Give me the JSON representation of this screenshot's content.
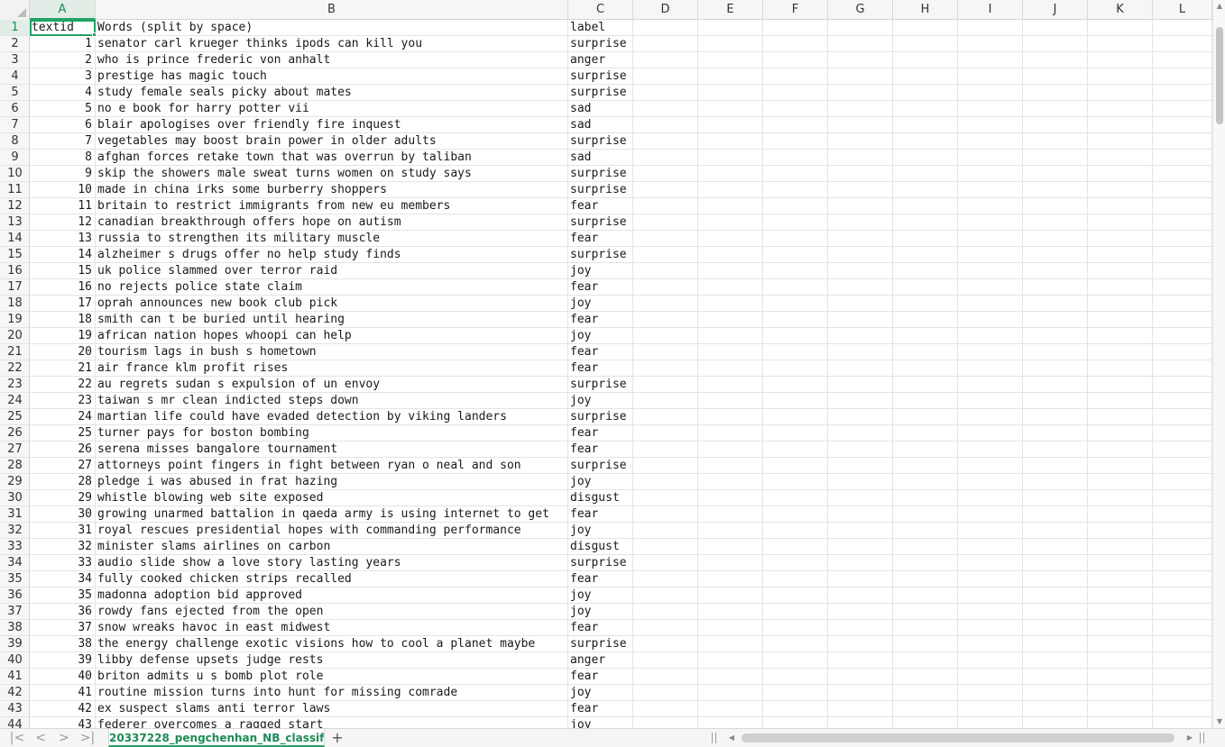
{
  "columns": [
    "A",
    "B",
    "C",
    "D",
    "E",
    "F",
    "G",
    "H",
    "I",
    "J",
    "K",
    "L"
  ],
  "selected_column": "A",
  "selected_row": "1",
  "header_row": {
    "a": "textid",
    "b": "Words (split by space)",
    "c": "label"
  },
  "data_rows": [
    {
      "id": "1",
      "text": "senator carl krueger thinks ipods can kill you",
      "label": "surprise"
    },
    {
      "id": "2",
      "text": "who is prince frederic von anhalt",
      "label": "anger"
    },
    {
      "id": "3",
      "text": "prestige has magic touch",
      "label": "surprise"
    },
    {
      "id": "4",
      "text": "study female seals picky about mates",
      "label": "surprise"
    },
    {
      "id": "5",
      "text": "no e book for harry potter vii",
      "label": "sad"
    },
    {
      "id": "6",
      "text": "blair apologises over friendly fire inquest",
      "label": "sad"
    },
    {
      "id": "7",
      "text": "vegetables may boost brain power in older adults",
      "label": "surprise"
    },
    {
      "id": "8",
      "text": "afghan forces retake town that was overrun by taliban",
      "label": "sad"
    },
    {
      "id": "9",
      "text": "skip the showers male sweat turns women on study says",
      "label": "surprise"
    },
    {
      "id": "10",
      "text": "made in china irks some burberry shoppers",
      "label": "surprise"
    },
    {
      "id": "11",
      "text": "britain to restrict immigrants from new eu members",
      "label": "fear"
    },
    {
      "id": "12",
      "text": "canadian breakthrough offers hope on autism",
      "label": "surprise"
    },
    {
      "id": "13",
      "text": "russia to strengthen its military muscle",
      "label": "fear"
    },
    {
      "id": "14",
      "text": "alzheimer s drugs offer no help study finds",
      "label": "surprise"
    },
    {
      "id": "15",
      "text": "uk police slammed over terror raid",
      "label": "joy"
    },
    {
      "id": "16",
      "text": "no rejects police state claim",
      "label": "fear"
    },
    {
      "id": "17",
      "text": "oprah announces new book club pick",
      "label": "joy"
    },
    {
      "id": "18",
      "text": "smith can t be buried until hearing",
      "label": "fear"
    },
    {
      "id": "19",
      "text": "african nation hopes whoopi can help",
      "label": "joy"
    },
    {
      "id": "20",
      "text": "tourism lags in bush s hometown",
      "label": "fear"
    },
    {
      "id": "21",
      "text": "air france klm profit rises",
      "label": "fear"
    },
    {
      "id": "22",
      "text": "au regrets sudan s expulsion of un envoy",
      "label": "surprise"
    },
    {
      "id": "23",
      "text": "taiwan s mr clean indicted steps down",
      "label": "joy"
    },
    {
      "id": "24",
      "text": "martian life could have evaded detection by viking landers",
      "label": "surprise"
    },
    {
      "id": "25",
      "text": "turner pays for boston bombing",
      "label": "fear"
    },
    {
      "id": "26",
      "text": "serena misses bangalore tournament",
      "label": "fear"
    },
    {
      "id": "27",
      "text": "attorneys point fingers in fight between ryan o neal and son",
      "label": "surprise"
    },
    {
      "id": "28",
      "text": "pledge i was abused in frat hazing",
      "label": "joy"
    },
    {
      "id": "29",
      "text": "whistle blowing web site exposed",
      "label": "disgust"
    },
    {
      "id": "30",
      "text": "growing unarmed battalion in qaeda army is using internet to get",
      "label": "fear"
    },
    {
      "id": "31",
      "text": "royal rescues presidential hopes with commanding performance",
      "label": "joy"
    },
    {
      "id": "32",
      "text": "minister slams airlines on carbon",
      "label": "disgust"
    },
    {
      "id": "33",
      "text": "audio slide show a love story lasting years",
      "label": "surprise"
    },
    {
      "id": "34",
      "text": "fully cooked chicken strips recalled",
      "label": "fear"
    },
    {
      "id": "35",
      "text": "madonna adoption bid approved",
      "label": "joy"
    },
    {
      "id": "36",
      "text": "rowdy fans ejected from the open",
      "label": "joy"
    },
    {
      "id": "37",
      "text": "snow wreaks havoc in east midwest",
      "label": "fear"
    },
    {
      "id": "38",
      "text": "the energy challenge exotic visions how to cool a planet maybe",
      "label": "surprise"
    },
    {
      "id": "39",
      "text": "libby defense upsets judge rests",
      "label": "anger"
    },
    {
      "id": "40",
      "text": "briton admits u s bomb plot role",
      "label": "fear"
    },
    {
      "id": "41",
      "text": "routine mission turns into hunt for missing comrade",
      "label": "joy"
    },
    {
      "id": "42",
      "text": "ex suspect slams anti terror laws",
      "label": "fear"
    },
    {
      "id": "43",
      "text": "federer overcomes a ragged start",
      "label": "joy"
    }
  ],
  "sheet_tab": {
    "label": "20337228_pengchenhan_NB_classif"
  },
  "nav": {
    "first": "K",
    "prev": "<",
    "next": ">",
    "last": ">|"
  },
  "add_sheet": "+",
  "colors": {
    "accent": "#21a366",
    "header_bg": "#f6f6f6",
    "grid_line": "#e1e4ea"
  }
}
